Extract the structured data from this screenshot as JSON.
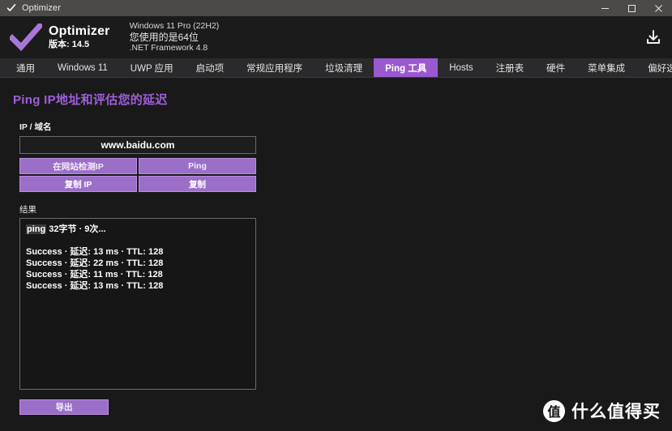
{
  "window": {
    "title": "Optimizer",
    "check_icon": "check-icon",
    "controls": [
      {
        "name": "minimize",
        "icon": "minimize-icon"
      },
      {
        "name": "maximize",
        "icon": "maximize-icon"
      },
      {
        "name": "close",
        "icon": "close-icon"
      }
    ]
  },
  "header": {
    "logo_icon": "check-icon",
    "brand_name": "Optimizer",
    "brand_version": "版本: 14.5",
    "sysinfo": {
      "os": "Windows 11 Pro (22H2)",
      "arch": "您使用的是64位",
      "framework": ".NET Framework 4.8"
    },
    "download_icon": "download-icon"
  },
  "tabs": [
    {
      "label": "通用",
      "active": false
    },
    {
      "label": "Windows 11",
      "active": false
    },
    {
      "label": "UWP 应用",
      "active": false
    },
    {
      "label": "启动项",
      "active": false
    },
    {
      "label": "常规应用程序",
      "active": false
    },
    {
      "label": "垃圾清理",
      "active": false
    },
    {
      "label": "Ping 工具",
      "active": true
    },
    {
      "label": "Hosts",
      "active": false
    },
    {
      "label": "注册表",
      "active": false
    },
    {
      "label": "硬件",
      "active": false
    },
    {
      "label": "菜单集成",
      "active": false
    },
    {
      "label": "偏好选项",
      "active": false
    }
  ],
  "page": {
    "title": "Ping IP地址和评估您的延迟",
    "ip_label": "IP / 域名",
    "ip_value": "www.baidu.com",
    "ip_placeholder": "IP / 域名",
    "buttons": [
      {
        "label": "在网站检测IP",
        "name": "detect-ip-on-website-button"
      },
      {
        "label": "Ping",
        "name": "ping-button"
      },
      {
        "label": "复制 IP",
        "name": "copy-ip-button"
      },
      {
        "label": "复制",
        "name": "copy-button"
      }
    ],
    "result_label": "结果",
    "result_header_prefix": "ping",
    "result_header_rest": "32字节 · 9次...",
    "result_lines": [
      "Success · 延迟: 13 ms · TTL: 128",
      "Success · 延迟: 22 ms · TTL: 128",
      "Success · 延迟: 11 ms · TTL: 128",
      "Success · 延迟: 13 ms · TTL: 128"
    ],
    "export_label": "导出"
  },
  "watermark": {
    "badge": "值",
    "text": "什么值得买"
  },
  "colors": {
    "accent": "#9b59d0",
    "button": "#9b6ec8",
    "title_text": "#a05fdc",
    "titlebar_bg": "#4c4a48",
    "tabbar_bg": "#2a2a2c",
    "page_bg": "#191919"
  }
}
